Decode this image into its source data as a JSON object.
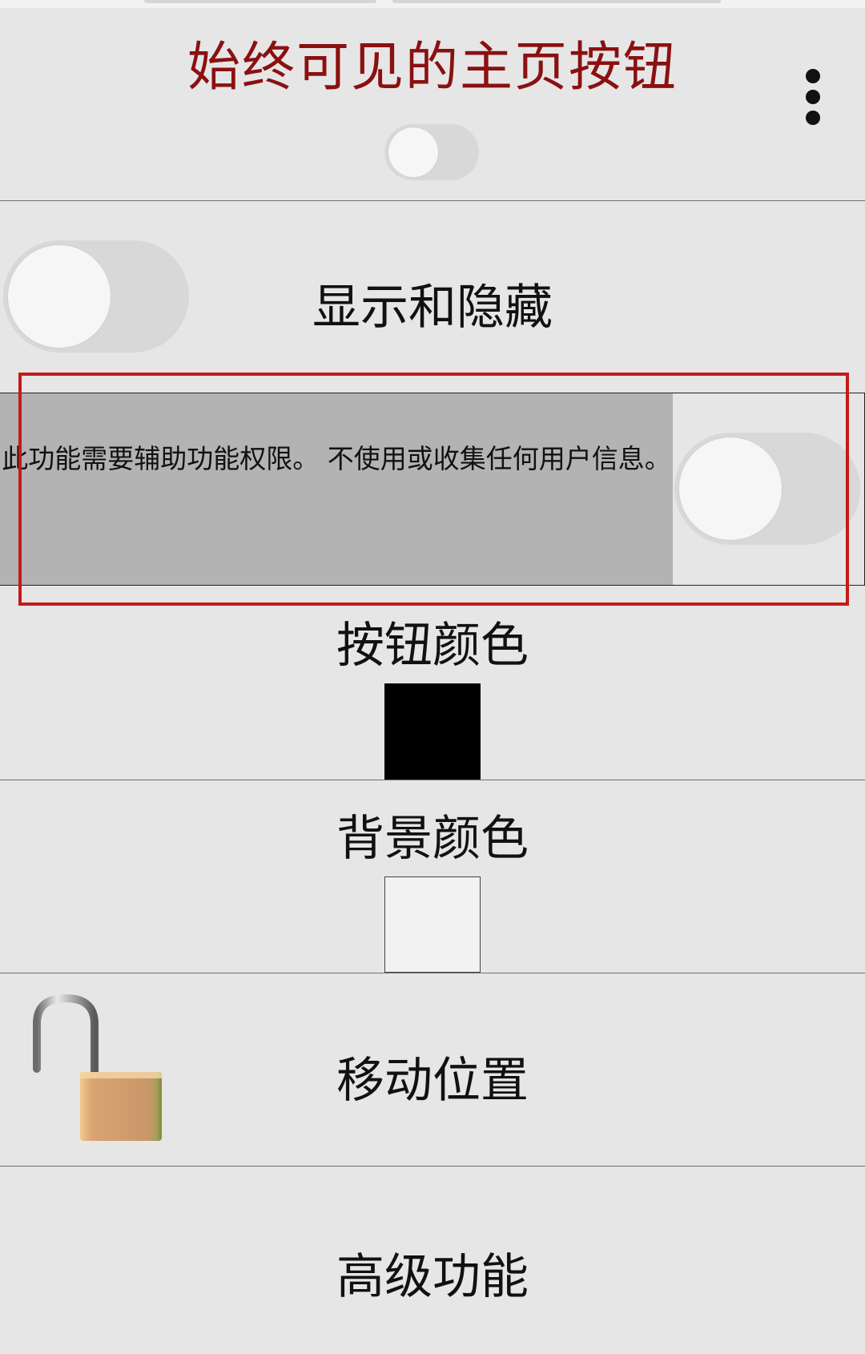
{
  "header": {
    "title": "始终可见的主页按钮",
    "menu_icon": "more-vertical-icon",
    "master_toggle_on": false
  },
  "rows": {
    "show_hide": {
      "label": "显示和隐藏",
      "toggle_on": false
    },
    "permission": {
      "text": "此功能需要辅助功能权限。 不使用或收集任何用户信息。",
      "toggle_on": false
    },
    "button_color": {
      "label": "按钮颜色",
      "color": "#000000"
    },
    "background_color": {
      "label": "背景颜色",
      "color": "#f2f2f2"
    },
    "move_position": {
      "label": "移动位置",
      "icon": "unlocked-padlock-icon"
    },
    "advanced": {
      "label": "高级功能"
    }
  },
  "colors": {
    "title": "#8b1010",
    "highlight_frame": "#c41a1a",
    "panel": "#b3b3b3",
    "background": "#e6e6e6"
  }
}
